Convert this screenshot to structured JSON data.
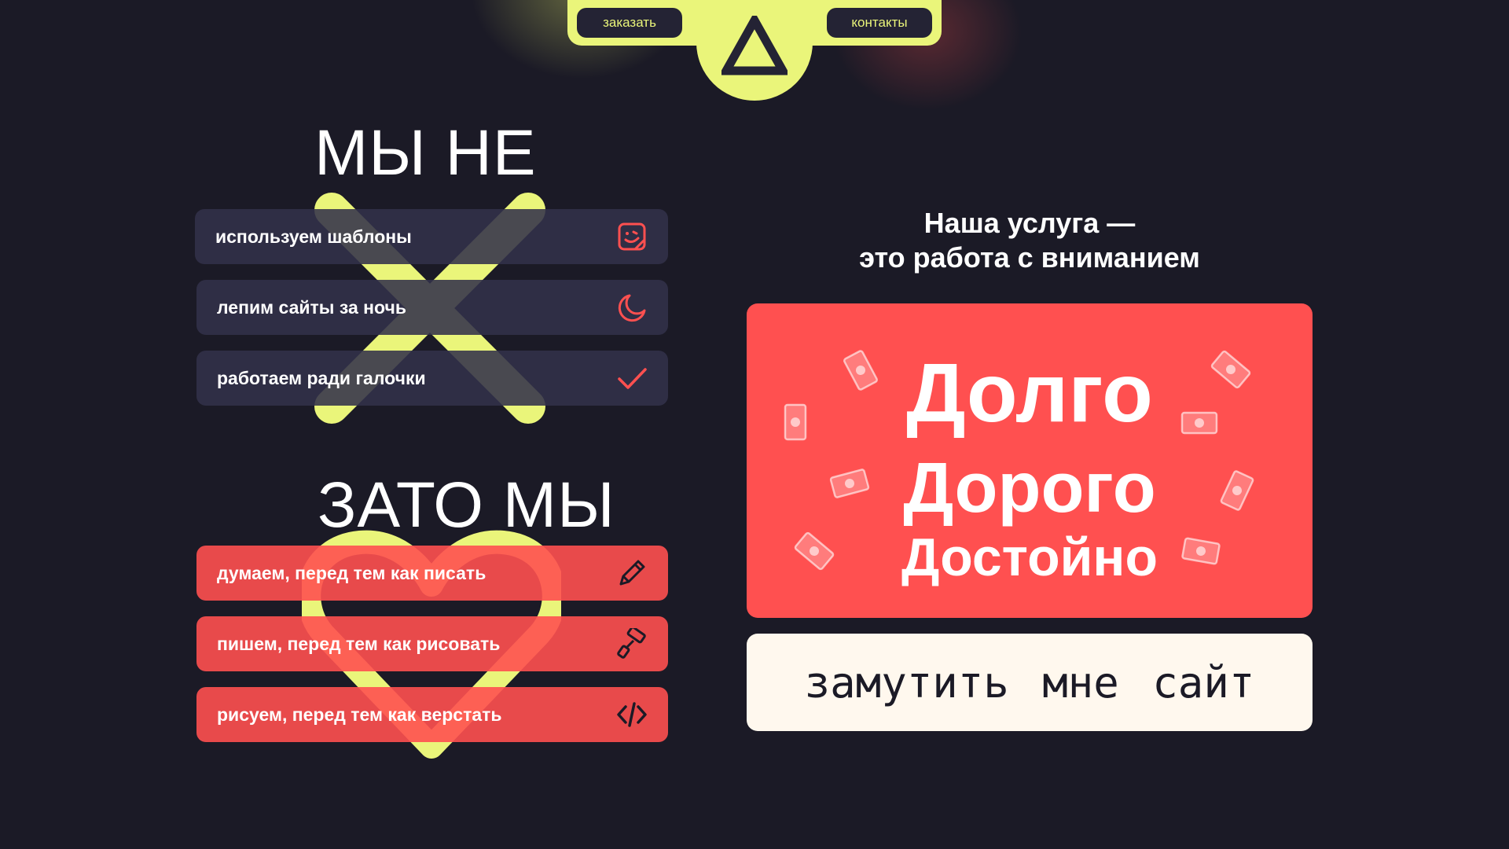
{
  "nav": {
    "order_label": "заказать",
    "contacts_label": "контакты",
    "logo_icon": "triangle-logo-icon"
  },
  "not_section": {
    "title": "МЫ НЕ",
    "items": [
      {
        "label": "используем шаблоны",
        "icon": "sticker-face-icon"
      },
      {
        "label": "лепим сайты за ночь",
        "icon": "moon-icon"
      },
      {
        "label": "работаем ради галочки",
        "icon": "checkmark-icon"
      }
    ]
  },
  "but_section": {
    "title": "ЗАТО МЫ",
    "items": [
      {
        "label": "думаем, перед тем как писать",
        "icon": "pencil-icon"
      },
      {
        "label": "пишем, перед тем как рисовать",
        "icon": "paint-roller-icon"
      },
      {
        "label": "рисуем, перед тем как верстать",
        "icon": "code-icon"
      }
    ]
  },
  "service": {
    "line1": "Наша услуга —",
    "line2": "это работа с вниманием"
  },
  "card": {
    "line1": "Долго",
    "line2": "Дорого",
    "line3": "Достойно",
    "decor_icon": "banknote-icon"
  },
  "cta": {
    "label": "замутить мне сайт"
  },
  "colors": {
    "background": "#1b1a26",
    "accent_yellow": "#eaf57a",
    "accent_red": "#ff5050",
    "dark_card": "#32314a",
    "cream": "#fff8ee"
  }
}
